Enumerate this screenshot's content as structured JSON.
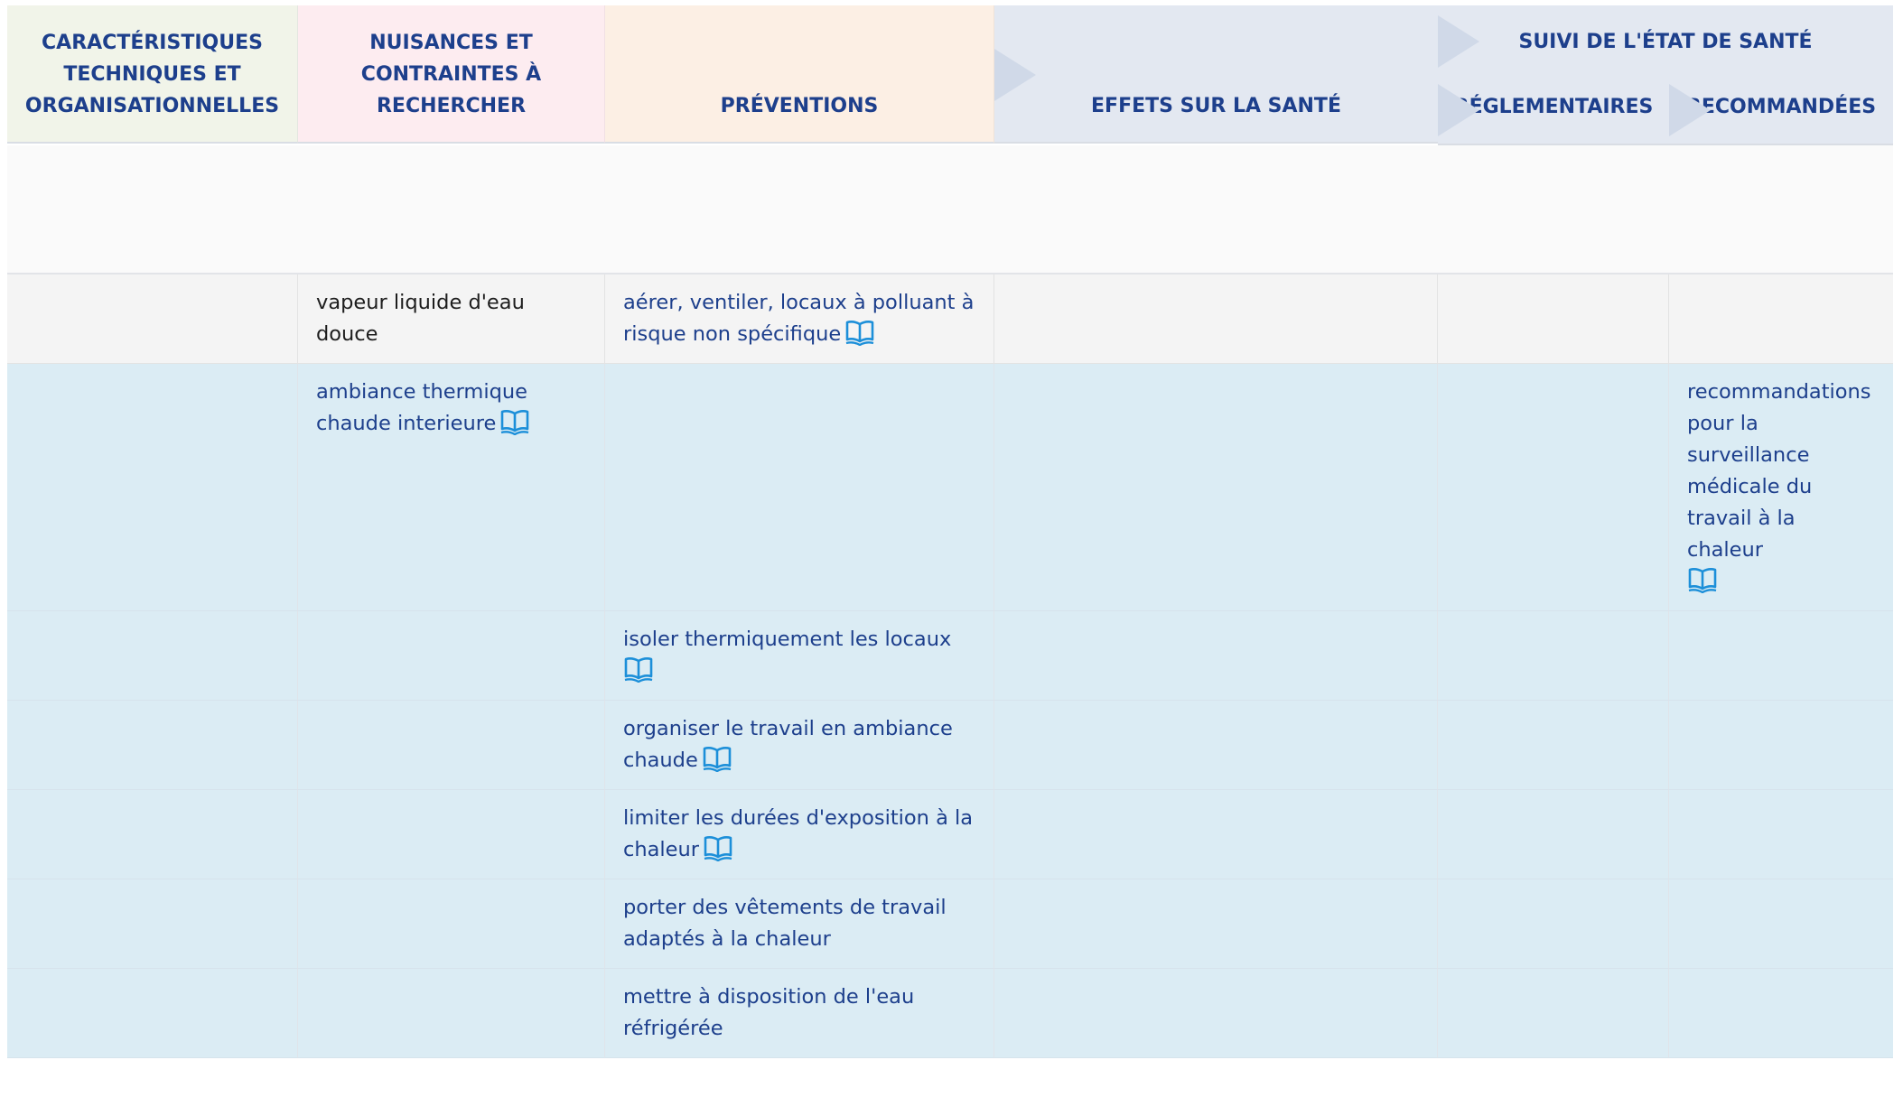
{
  "header": {
    "carac": "CARACTÉRISTIQUES TECHNIQUES ET ORGANISATIONNELLES",
    "nuisances": "NUISANCES ET CONTRAINTES À RECHERCHER",
    "preventions": "PRÉVENTIONS",
    "effets": "EFFETS SUR LA SANTÉ",
    "suivi_group": "SUIVI DE L'ÉTAT DE SANTÉ",
    "reglementaires": "RÉGLEMENTAIRES",
    "recommandees": "RECOMMANDÉES"
  },
  "rows": [
    {
      "style": "grey",
      "nuisance": "vapeur liquide d'eau douce",
      "prevention": "aérer, ventiler, locaux à polluant à risque non spécifique",
      "recommandee": ""
    },
    {
      "style": "blue",
      "nuisance": "ambiance thermique chaude interieure",
      "prevention": "",
      "recommandee": "recommandations pour la surveillance médicale du travail à la chaleur"
    },
    {
      "style": "blue",
      "nuisance": "",
      "prevention": "isoler thermiquement les locaux",
      "recommandee": ""
    },
    {
      "style": "blue",
      "nuisance": "",
      "prevention": "organiser le travail en ambiance chaude",
      "recommandee": ""
    },
    {
      "style": "blue",
      "nuisance": "",
      "prevention": "limiter les durées d'exposition à la chaleur",
      "recommandee": ""
    },
    {
      "style": "blue",
      "nuisance": "",
      "prevention": "porter des vêtements de travail adaptés à la chaleur",
      "recommandee": ""
    },
    {
      "style": "blue",
      "nuisance": "",
      "prevention": "mettre à disposition de l'eau réfrigérée",
      "recommandee": ""
    }
  ],
  "icons": {
    "reference": "book-icon"
  },
  "colors": {
    "link": "#1d3f8c",
    "icon": "#1c8fd9",
    "row_blue": "#dbecf4",
    "row_grey": "#f4f4f4"
  }
}
